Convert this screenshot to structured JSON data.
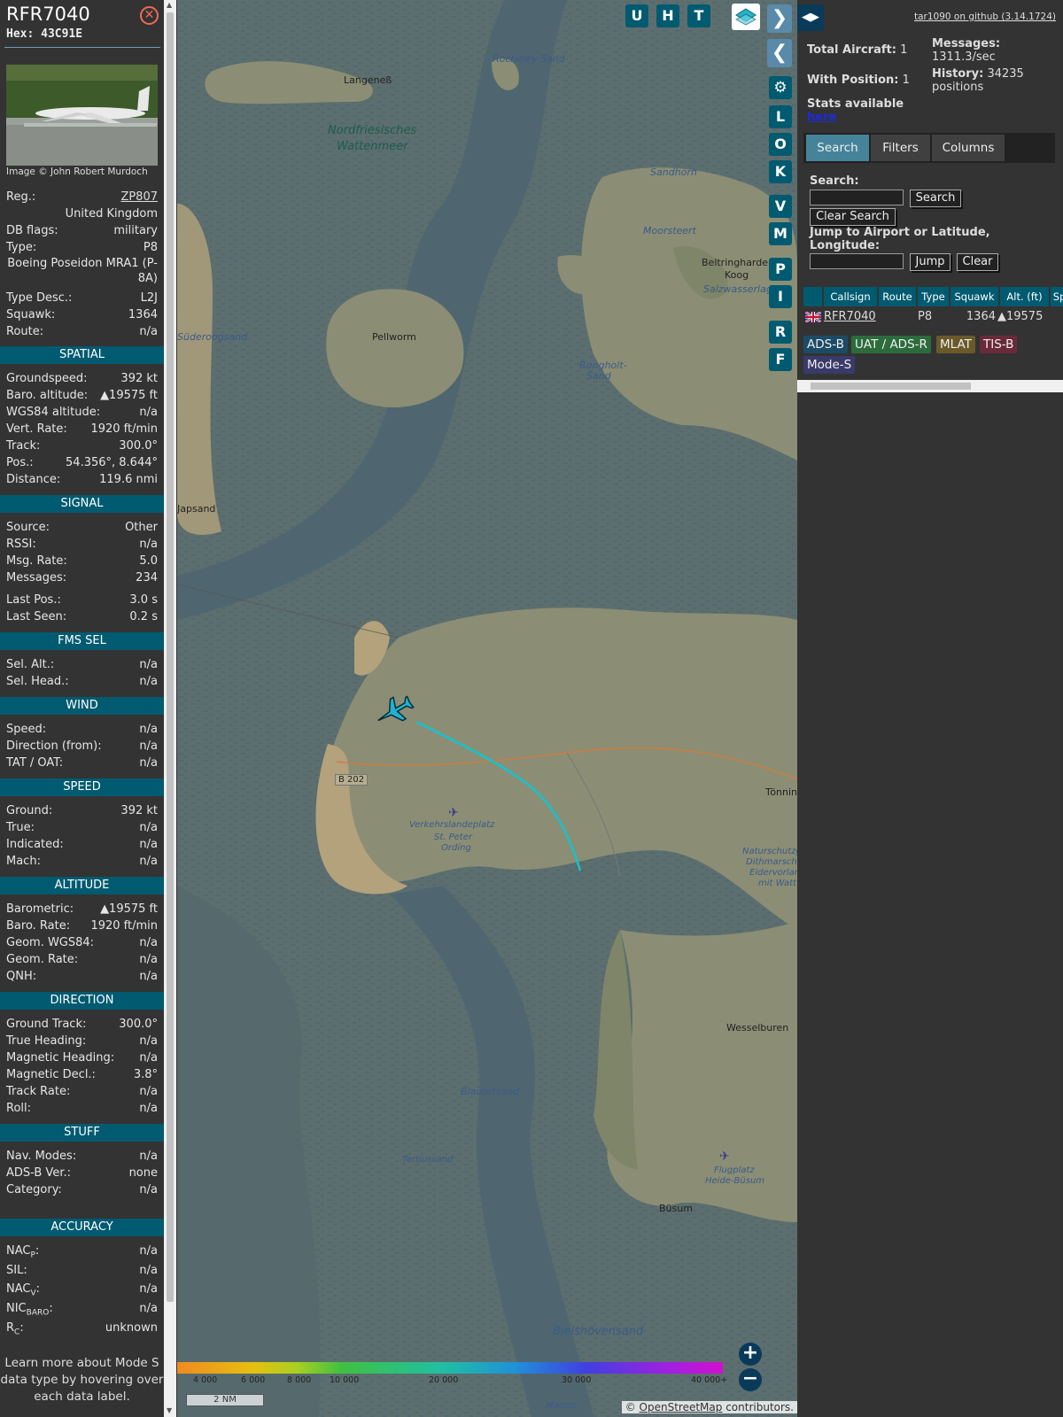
{
  "aircraft": {
    "callsign": "RFR7040",
    "hex_label": "Hex:",
    "hex": "43C91E",
    "photo_credit": "Image © John Robert Murdoch",
    "fields": [
      {
        "key": "Reg.:",
        "val": "ZP807"
      },
      {
        "key": "",
        "val": "United Kingdom"
      },
      {
        "key": "DB flags:",
        "val": "military"
      },
      {
        "key": "Type:",
        "val": "P8"
      },
      {
        "key": "",
        "val": "Boeing Poseidon MRA1 (P-8A)"
      },
      {
        "key": "Type Desc.:",
        "val": "L2J"
      },
      {
        "key": "Squawk:",
        "val": "1364"
      },
      {
        "key": "Route:",
        "val": "n/a"
      }
    ]
  },
  "sections": {
    "spatial": {
      "title": "SPATIAL",
      "rows": [
        {
          "key": "Groundspeed:",
          "val": "392 kt"
        },
        {
          "key": "Baro. altitude:",
          "val": "▲19575 ft"
        },
        {
          "key": "WGS84 altitude:",
          "val": "n/a"
        },
        {
          "key": "Vert. Rate:",
          "val": "1920 ft/min"
        },
        {
          "key": "Track:",
          "val": "300.0°"
        },
        {
          "key": "Pos.:",
          "val": "54.356°, 8.644°"
        },
        {
          "key": "Distance:",
          "val": "119.6 nmi"
        }
      ]
    },
    "signal": {
      "title": "SIGNAL",
      "rows": [
        {
          "key": "Source:",
          "val": "Other"
        },
        {
          "key": "RSSI:",
          "val": "n/a"
        },
        {
          "key": "Msg. Rate:",
          "val": "5.0"
        },
        {
          "key": "Messages:",
          "val": "234"
        },
        {
          "key": "Last Pos.:",
          "val": "3.0 s"
        },
        {
          "key": "Last Seen:",
          "val": "0.2 s"
        }
      ]
    },
    "fms": {
      "title": "FMS SEL",
      "rows": [
        {
          "key": "Sel. Alt.:",
          "val": "n/a"
        },
        {
          "key": "Sel. Head.:",
          "val": "n/a"
        }
      ]
    },
    "wind": {
      "title": "WIND",
      "rows": [
        {
          "key": "Speed:",
          "val": "n/a"
        },
        {
          "key": "Direction (from):",
          "val": "n/a"
        },
        {
          "key": "TAT / OAT:",
          "val": "n/a"
        }
      ]
    },
    "speed": {
      "title": "SPEED",
      "rows": [
        {
          "key": "Ground:",
          "val": "392 kt"
        },
        {
          "key": "True:",
          "val": "n/a"
        },
        {
          "key": "Indicated:",
          "val": "n/a"
        },
        {
          "key": "Mach:",
          "val": "n/a"
        }
      ]
    },
    "altitude": {
      "title": "ALTITUDE",
      "rows": [
        {
          "key": "Barometric:",
          "val": "▲19575 ft"
        },
        {
          "key": "Baro. Rate:",
          "val": "1920 ft/min"
        },
        {
          "key": "Geom. WGS84:",
          "val": "n/a"
        },
        {
          "key": "Geom. Rate:",
          "val": "n/a"
        },
        {
          "key": "QNH:",
          "val": "n/a"
        }
      ]
    },
    "direction": {
      "title": "DIRECTION",
      "rows": [
        {
          "key": "Ground Track:",
          "val": "300.0°"
        },
        {
          "key": "True Heading:",
          "val": "n/a"
        },
        {
          "key": "Magnetic Heading:",
          "val": "n/a"
        },
        {
          "key": "Magnetic Decl.:",
          "val": "3.8°"
        },
        {
          "key": "Track Rate:",
          "val": "n/a"
        },
        {
          "key": "Roll:",
          "val": "n/a"
        }
      ]
    },
    "stuff": {
      "title": "STUFF",
      "rows": [
        {
          "key": "Nav. Modes:",
          "val": "n/a"
        },
        {
          "key": "ADS-B Ver.:",
          "val": "none"
        },
        {
          "key": "Category:",
          "val": "n/a"
        }
      ]
    },
    "accuracy": {
      "title": "ACCURACY",
      "rows": [
        {
          "key": "NAC",
          "sub": "P",
          "val": "n/a"
        },
        {
          "key": "SIL:",
          "sub": "",
          "val": "n/a"
        },
        {
          "key": "NAC",
          "sub": "V",
          "val": "n/a"
        },
        {
          "key": "NIC",
          "sub": "BARO",
          "val": "n/a"
        },
        {
          "key": "R",
          "sub": "C",
          "val": "unknown"
        }
      ]
    }
  },
  "footnote": "Learn more about Mode S data type by hovering over each data label.",
  "map": {
    "buttons": [
      "U",
      "H",
      "T",
      "L",
      "O",
      "K",
      "V",
      "M",
      "P",
      "I",
      "R",
      "F"
    ],
    "labels": [
      {
        "text": "Langeneß",
        "cls": ""
      },
      {
        "text": "Rocheley-Sand",
        "cls": "water"
      },
      {
        "text": "Nordfriesisches",
        "cls": "big"
      },
      {
        "text": "Wattenmeer",
        "cls": "big"
      },
      {
        "text": "Sandhorn",
        "cls": "water"
      },
      {
        "text": "Moorsteert",
        "cls": "water"
      },
      {
        "text": "Beltringharder",
        "cls": ""
      },
      {
        "text": "Koog",
        "cls": ""
      },
      {
        "text": "Salzwasserlagune",
        "cls": "water"
      },
      {
        "text": "Pellworm",
        "cls": ""
      },
      {
        "text": "Süderoogsand",
        "cls": ""
      },
      {
        "text": "Rungholt-",
        "cls": "water"
      },
      {
        "text": "Sand",
        "cls": "water"
      },
      {
        "text": "Japsand",
        "cls": ""
      },
      {
        "text": "B 202",
        "cls": ""
      },
      {
        "text": "Tönning",
        "cls": ""
      },
      {
        "text": "Verkehrslandeplatz",
        "cls": "water"
      },
      {
        "text": "St. Peter",
        "cls": "water"
      },
      {
        "text": "Ording",
        "cls": "water"
      },
      {
        "text": "Naturschutzgebiet",
        "cls": "water"
      },
      {
        "text": "Dithmarscher",
        "cls": "water"
      },
      {
        "text": "Eidervorland",
        "cls": "water"
      },
      {
        "text": "mit Watt",
        "cls": "water"
      },
      {
        "text": "Wesselburen",
        "cls": ""
      },
      {
        "text": "Blauortsand",
        "cls": "water"
      },
      {
        "text": "Tertiussand",
        "cls": "water"
      },
      {
        "text": "Flugplatz",
        "cls": "water"
      },
      {
        "text": "Heide-Büsum",
        "cls": "water"
      },
      {
        "text": "Büsum",
        "cls": ""
      },
      {
        "text": "Bielshövensand",
        "cls": "water"
      },
      {
        "text": "Marner",
        "cls": "water"
      }
    ],
    "alt_scale": [
      "4 000",
      "6 000",
      "8 000",
      "10 000",
      "20 000",
      "30 000",
      "40 000+"
    ],
    "scale": "2 NM",
    "attribution_prefix": "© ",
    "attribution_link": "OpenStreetMap",
    "attribution_suffix": " contributors."
  },
  "right": {
    "github": "tar1090 on github (3.14.1724)",
    "total_aircraft_label": "Total Aircraft:",
    "total_aircraft": "1",
    "with_position_label": "With Position:",
    "with_position": "1",
    "messages_label": "Messages:",
    "messages": "1311.3/sec",
    "history_label": "History:",
    "history": "34235 positions",
    "stats_label": "Stats available",
    "stats_link": "here",
    "tabs": [
      "Search",
      "Filters",
      "Columns"
    ],
    "search_label": "Search:",
    "search_value": "",
    "search_button": "Search",
    "clear_search_button": "Clear Search",
    "jump_label": "Jump to Airport or Latitude, Longitude:",
    "jump_value": "",
    "jump_button": "Jump",
    "clear_button": "Clear",
    "table_headers": [
      "Callsign",
      "Route",
      "Type",
      "Squawk",
      "Alt. (ft)",
      "Sp"
    ],
    "table_row": {
      "callsign": "RFR7040",
      "type": "P8",
      "squawk": "1364",
      "alt": "▲19575"
    },
    "source_badges": [
      {
        "label": "ADS-B",
        "color": "#1c4b66"
      },
      {
        "label": "UAT / ADS-R",
        "color": "#2c6b3c"
      },
      {
        "label": "MLAT",
        "color": "#6a5a2a"
      },
      {
        "label": "TIS-B",
        "color": "#6a2a3a"
      },
      {
        "label": "Mode-S",
        "color": "#3a3a6a"
      }
    ]
  }
}
